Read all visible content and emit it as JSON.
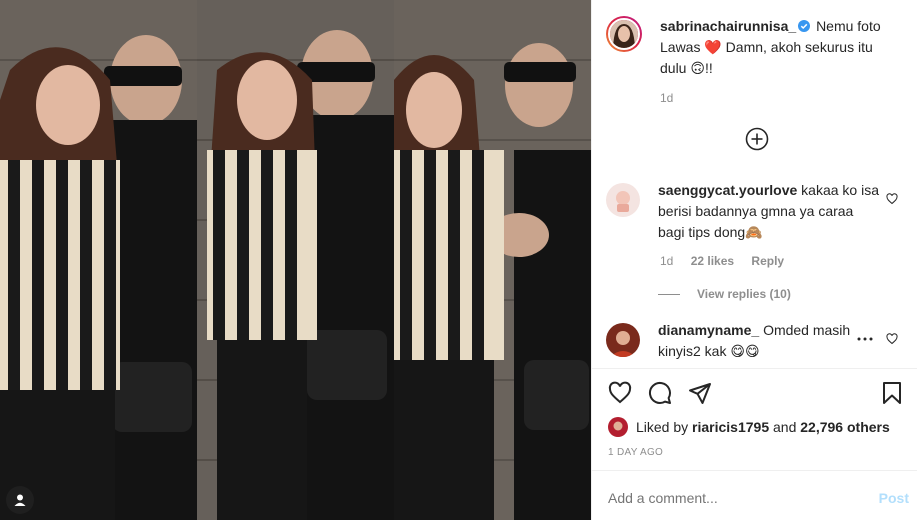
{
  "post": {
    "username": "sabrinachairunnisa_",
    "caption_text": "Nemu foto Lawas ❤️ Damn, akoh sekurus itu dulu 🙃!!",
    "age": "1d"
  },
  "comments": [
    {
      "username": "saenggycat.yourlove",
      "text": "kakaa ko isa berisi badannya gmna ya caraa bagi tips dong🙈",
      "age": "1d",
      "likes": "22 likes",
      "reply": "Reply",
      "view_replies": "View replies (10)"
    },
    {
      "username": "dianamyname_",
      "text": "Omded masih kinyis2 kak 😋😋"
    }
  ],
  "likes": {
    "prefix": "Liked by",
    "user": "riaricis1795",
    "connector": "and",
    "count": "22,796 others"
  },
  "date": "1 DAY AGO",
  "composer": {
    "placeholder": "Add a comment...",
    "post_label": "Post"
  },
  "icons": [
    "user-tag-icon",
    "verified-icon",
    "load-more-icon",
    "heart-icon",
    "comment-icon",
    "share-icon",
    "save-icon",
    "more-options-icon"
  ],
  "colors": {
    "accent": "#0095f6",
    "verified": "#3897f0",
    "muted": "#8e8e8e",
    "post_disabled": "#b2dffc"
  }
}
